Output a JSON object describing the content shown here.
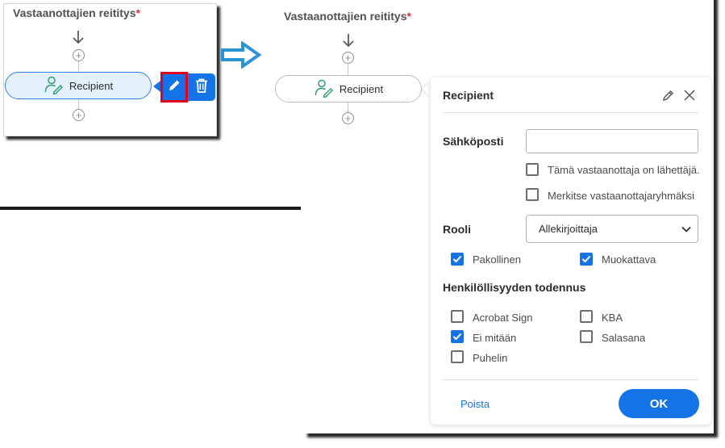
{
  "routing": {
    "title": "Vastaanottajien reititys",
    "required_mark": "*"
  },
  "recipient_node": {
    "label": "Recipient",
    "icon": "user-sign-icon"
  },
  "node_actions": {
    "edit_icon": "pencil-icon",
    "delete_icon": "trash-icon"
  },
  "transition_arrow": {
    "icon": "right-arrow-icon",
    "color": "#2a95d6"
  },
  "dialog": {
    "title": "Recipient",
    "email": {
      "label": "Sähköposti",
      "value": "",
      "placeholder": ""
    },
    "options": [
      {
        "label": "Tämä vastaanottaja on lähettäjä.",
        "checked": false
      },
      {
        "label": "Merkitse vastaanottajaryhmäksi",
        "checked": false
      }
    ],
    "role": {
      "label": "Rooli",
      "selected": "Allekirjoittaja"
    },
    "role_flags": [
      {
        "label": "Pakollinen",
        "checked": true
      },
      {
        "label": "Muokattava",
        "checked": true
      }
    ],
    "auth": {
      "heading": "Henkilöllisyyden todennus",
      "methods": [
        {
          "label": "Acrobat Sign",
          "checked": false
        },
        {
          "label": "KBA",
          "checked": false
        },
        {
          "label": "Ei mitään",
          "checked": true
        },
        {
          "label": "Salasana",
          "checked": false
        },
        {
          "label": "Puhelin",
          "checked": false
        }
      ]
    },
    "delete_label": "Poista",
    "ok_label": "OK"
  },
  "colors": {
    "accent": "#1473e6",
    "highlight_frame": "#e3001b",
    "required": "#d7373f",
    "node_fill": "#e4f0fb"
  }
}
